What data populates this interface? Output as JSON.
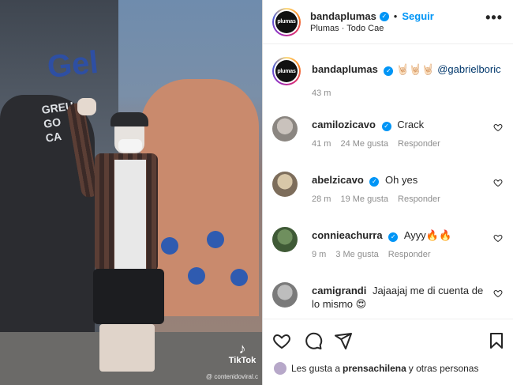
{
  "post": {
    "username": "bandaplumas",
    "follow_label": "Seguir",
    "dot": "•",
    "audio": "Plumas · Todo Cae",
    "more_label": "•••",
    "avatar_text": "plumas"
  },
  "caption": {
    "username": "bandaplumas",
    "emoji": "🤘🏻🤘🏻🤘🏻",
    "mention": "@gabrielboric",
    "time": "43 m"
  },
  "comments": [
    {
      "username": "camilozicavo",
      "verified": true,
      "text": "Crack",
      "time": "41 m",
      "likes": "24 Me gusta",
      "reply": "Responder"
    },
    {
      "username": "abelzicavo",
      "verified": true,
      "text": "Oh yes",
      "time": "28 m",
      "likes": "19 Me gusta",
      "reply": "Responder"
    },
    {
      "username": "connieachurra",
      "verified": true,
      "text": "Ayyy🔥🔥",
      "time": "9 m",
      "likes": "3 Me gusta",
      "reply": "Responder"
    },
    {
      "username": "camigrandi",
      "verified": false,
      "text": "Jajaajaj me di cuenta de lo mismo 😍",
      "time": "",
      "likes": "",
      "reply": ""
    }
  ],
  "likes_line": {
    "prefix": "Les gusta a",
    "user": "prensachilena",
    "suffix": "y otras personas"
  },
  "video_overlay": {
    "logo": "♪",
    "brand": "TikTok",
    "handle": "@ contenidoviral.c"
  },
  "colors": {
    "accent": "#0095f6",
    "text": "#262626",
    "muted": "#8e8e8e"
  },
  "icons": [
    "heart-icon",
    "comment-icon",
    "share-icon",
    "bookmark-icon",
    "more-icon",
    "verified-icon"
  ]
}
